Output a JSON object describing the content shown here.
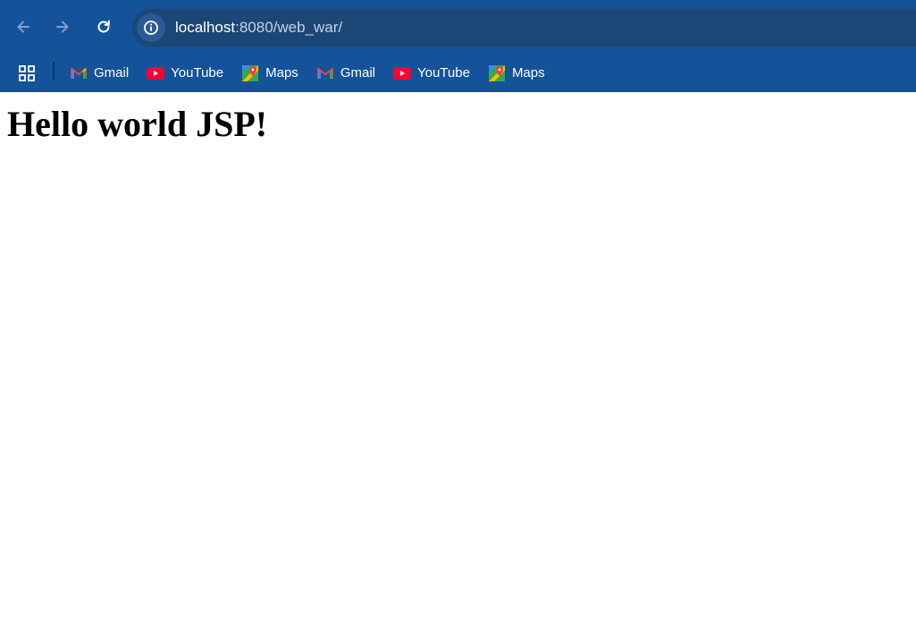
{
  "browser": {
    "url_host": "localhost",
    "url_rest": ":8080/web_war/",
    "colors": {
      "chrome_bg": "#14539a",
      "omnibox_bg": "#1c4676"
    },
    "icons": {
      "back": "back-arrow-icon",
      "forward": "forward-arrow-icon",
      "reload": "reload-icon",
      "site_info": "info-icon",
      "apps": "apps-grid-icon"
    },
    "bookmarks": [
      {
        "label": "Gmail",
        "icon": "gmail-icon"
      },
      {
        "label": "YouTube",
        "icon": "youtube-icon"
      },
      {
        "label": "Maps",
        "icon": "maps-icon"
      },
      {
        "label": "Gmail",
        "icon": "gmail-icon"
      },
      {
        "label": "YouTube",
        "icon": "youtube-icon"
      },
      {
        "label": "Maps",
        "icon": "maps-icon"
      }
    ]
  },
  "page": {
    "heading": "Hello world JSP!"
  }
}
